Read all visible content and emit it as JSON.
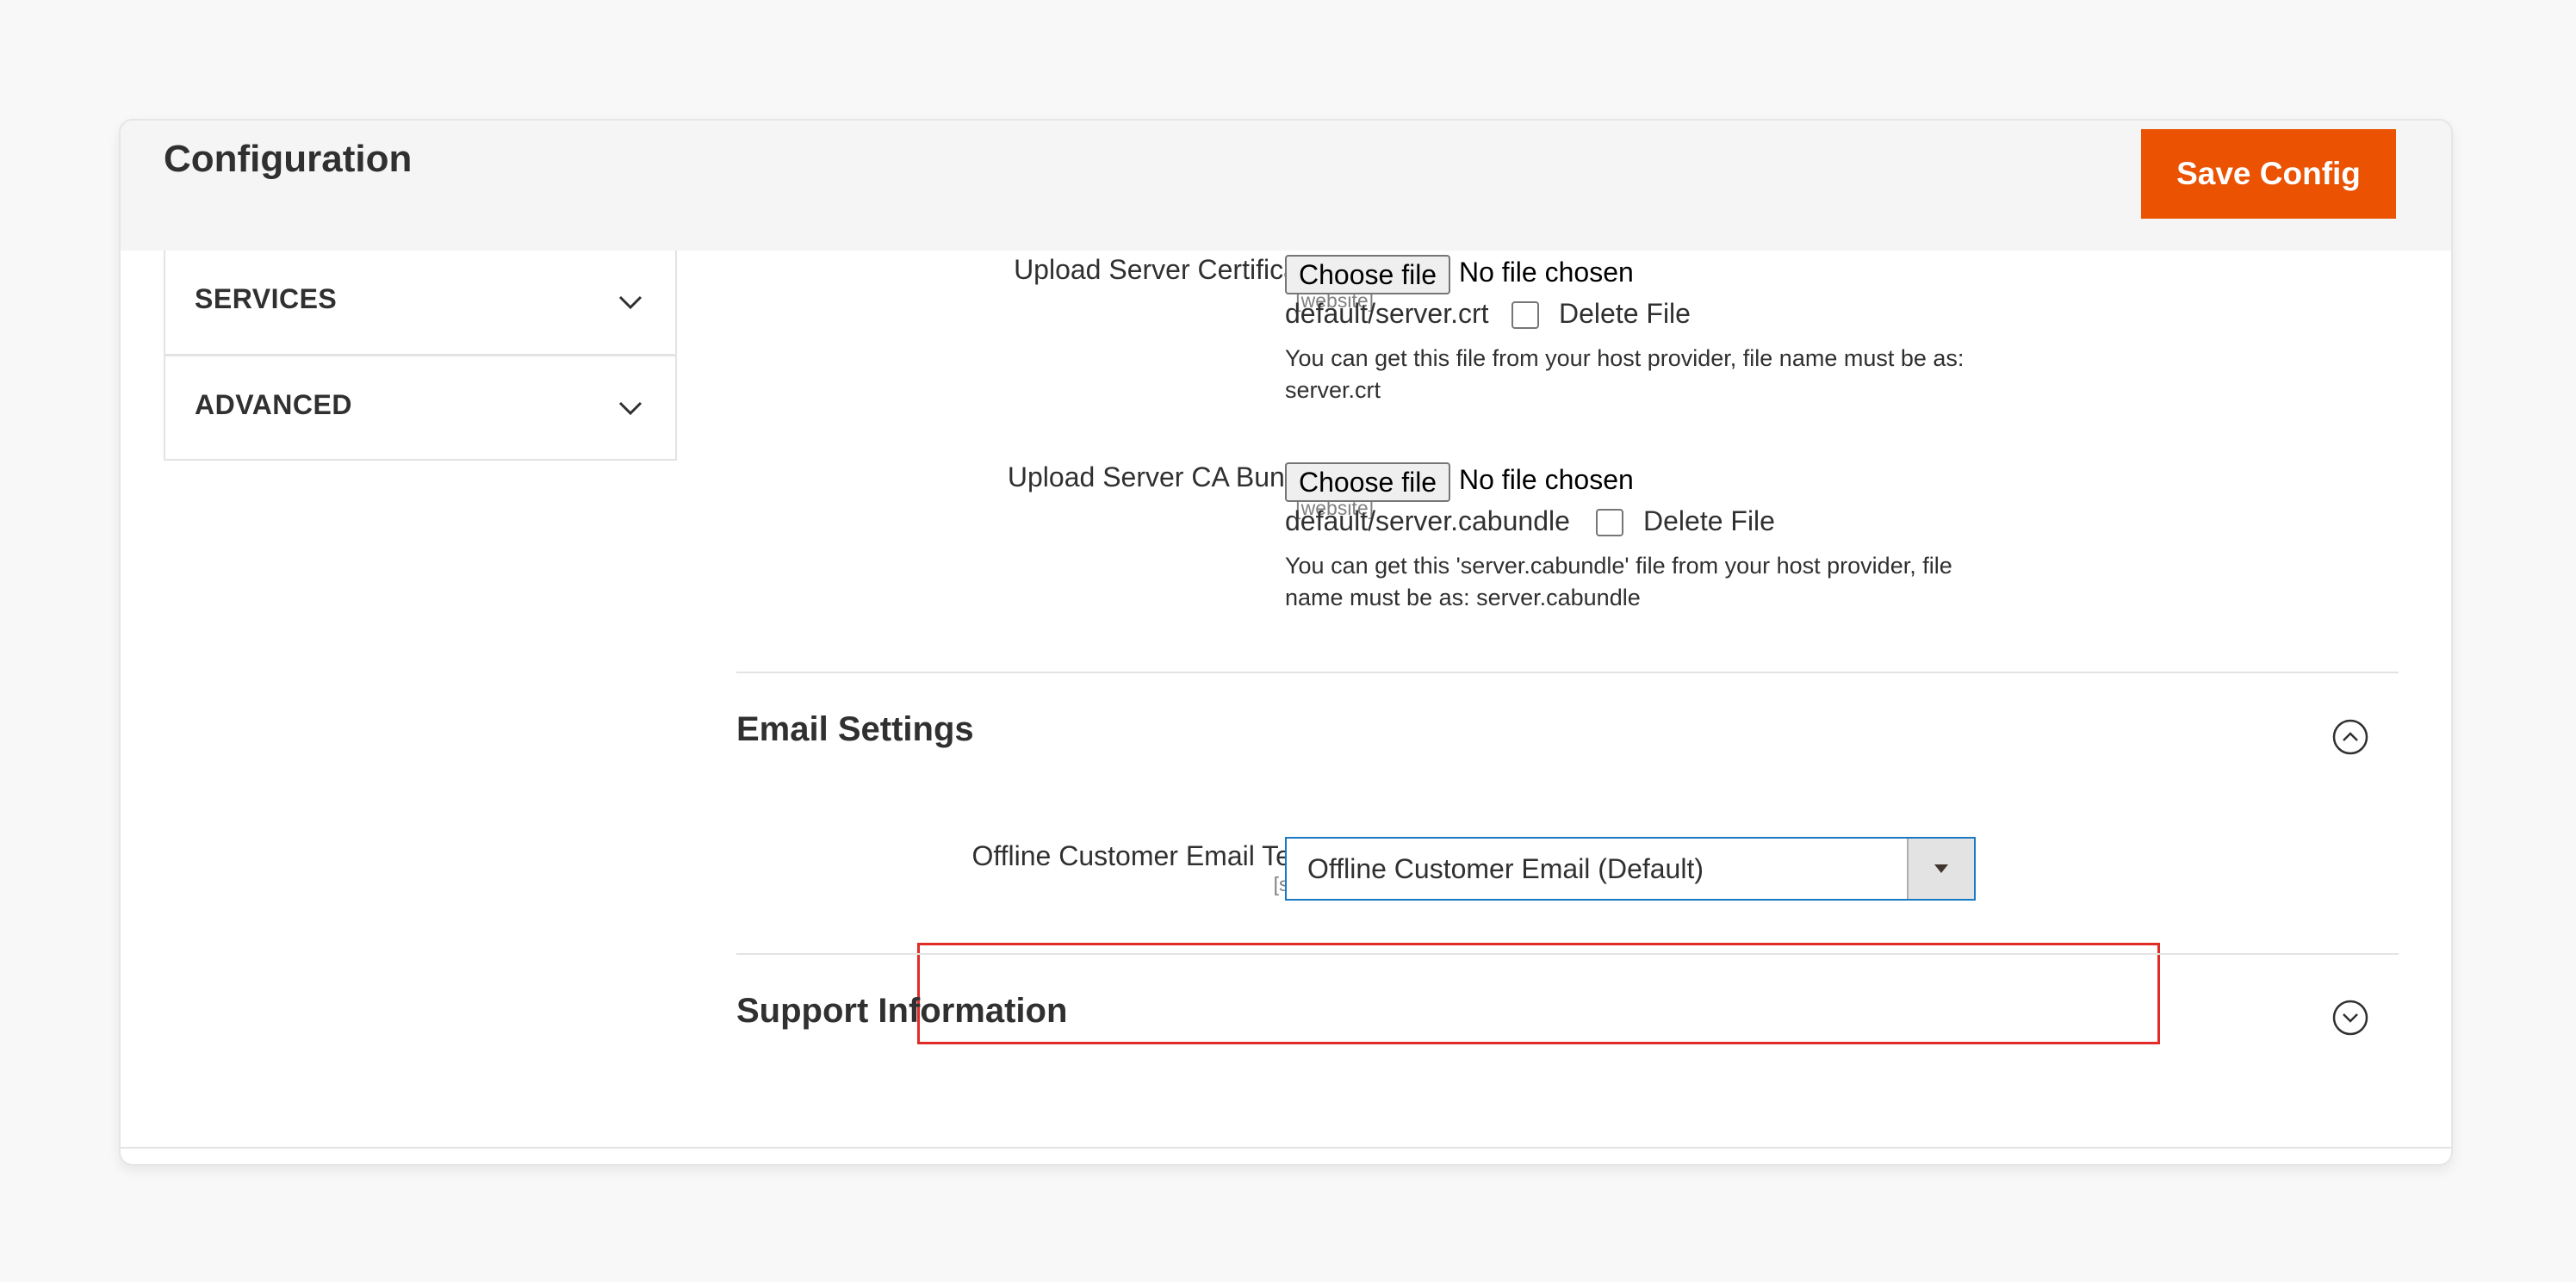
{
  "header": {
    "title": "Configuration",
    "save_label": "Save Config",
    "save_color": "#eb5202"
  },
  "sidebar": {
    "tabs": [
      {
        "label": "SERVICES",
        "icon": "chevron-down-icon"
      },
      {
        "label": "ADVANCED",
        "icon": "chevron-down-icon"
      }
    ]
  },
  "fields": {
    "cert": {
      "label": "Upload Server Certificate File",
      "scope": "[website]",
      "button": "Choose file",
      "no_file": "No file chosen",
      "current_file": "default/server.crt",
      "delete_label": "Delete File",
      "note": "You can get this file from your host provider, file name must be as: server.crt"
    },
    "ca": {
      "label": "Upload Server CA Bundle File",
      "scope": "[website]",
      "button": "Choose file",
      "no_file": "No file chosen",
      "current_file": "default/server.cabundle",
      "delete_label": "Delete File",
      "note": "You can get this 'server.cabundle' file from your host provider, file name must be as: server.cabundle"
    }
  },
  "sections": {
    "email": {
      "title": "Email Settings",
      "expanded": true,
      "template_label": "Offline Customer Email Template",
      "template_scope": "[store view]",
      "template_value": "Offline Customer Email (Default)"
    },
    "support": {
      "title": "Support Information",
      "expanded": false
    }
  },
  "colors": {
    "highlight": "#e02b27",
    "select_focus": "#1979c3"
  }
}
